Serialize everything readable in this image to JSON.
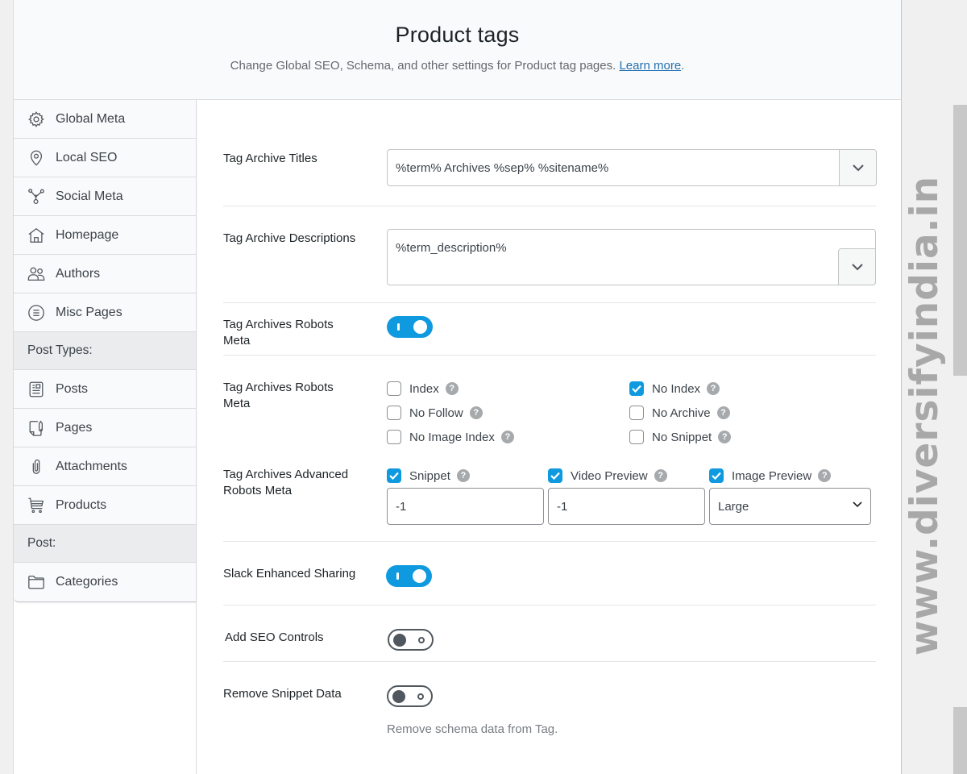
{
  "header": {
    "title": "Product tags",
    "description": "Change Global SEO, Schema, and other settings for Product tag pages.",
    "learn_more": "Learn more",
    "period": "."
  },
  "sidebar": {
    "items": [
      {
        "label": "Global Meta",
        "icon": "gear-icon"
      },
      {
        "label": "Local SEO",
        "icon": "location-pin-icon"
      },
      {
        "label": "Social Meta",
        "icon": "share-nodes-icon"
      },
      {
        "label": "Homepage",
        "icon": "home-icon"
      },
      {
        "label": "Authors",
        "icon": "users-icon"
      },
      {
        "label": "Misc Pages",
        "icon": "list-circle-icon"
      }
    ],
    "group_post_types": "Post Types:",
    "post_types": [
      {
        "label": "Posts",
        "icon": "post-icon"
      },
      {
        "label": "Pages",
        "icon": "page-icon"
      },
      {
        "label": "Attachments",
        "icon": "paperclip-icon"
      },
      {
        "label": "Products",
        "icon": "cart-icon"
      }
    ],
    "group_post": "Post:",
    "post": [
      {
        "label": "Categories",
        "icon": "folder-icon"
      }
    ]
  },
  "settings": {
    "archive_titles": {
      "label": "Tag Archive Titles",
      "value": "%term% Archives %sep% %sitename%"
    },
    "archive_descriptions": {
      "label": "Tag Archive Descriptions",
      "value": "%term_description%"
    },
    "robots_meta_toggle": {
      "label": "Tag Archives Robots Meta",
      "enabled": true
    },
    "robots_meta": {
      "label": "Tag Archives Robots Meta",
      "options": [
        {
          "label": "Index",
          "checked": false
        },
        {
          "label": "No Index",
          "checked": true
        },
        {
          "label": "No Follow",
          "checked": false
        },
        {
          "label": "No Archive",
          "checked": false
        },
        {
          "label": "No Image Index",
          "checked": false
        },
        {
          "label": "No Snippet",
          "checked": false
        }
      ]
    },
    "advanced_robots": {
      "label": "Tag Archives Advanced Robots Meta",
      "snippet": {
        "label": "Snippet",
        "checked": true,
        "value": "-1"
      },
      "video_preview": {
        "label": "Video Preview",
        "checked": true,
        "value": "-1"
      },
      "image_preview": {
        "label": "Image Preview",
        "checked": true,
        "value": "Large"
      }
    },
    "slack_sharing": {
      "label": "Slack Enhanced Sharing",
      "enabled": true
    },
    "seo_controls": {
      "label": "Add SEO Controls",
      "enabled": false
    },
    "remove_snippet": {
      "label": "Remove Snippet Data",
      "enabled": false,
      "description": "Remove schema data from Tag."
    }
  },
  "help_glyph": "?",
  "watermark": "www.diversifyindia.in",
  "colors": {
    "accent": "#0f9ae0",
    "link": "#2271b1",
    "help": "#a7aaad"
  }
}
